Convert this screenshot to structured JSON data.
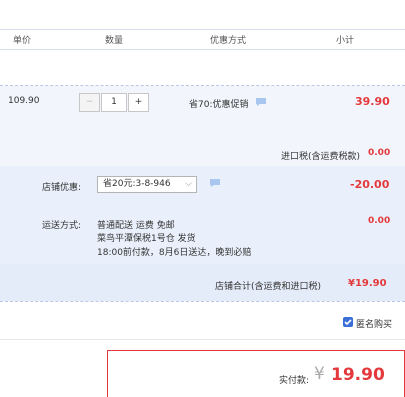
{
  "table_header": {
    "unit_price": "单价",
    "quantity": "数量",
    "discount_method": "优惠方式",
    "subtotal": "小计"
  },
  "item": {
    "unit_price": "109.90",
    "quantity": "1",
    "minus": "−",
    "plus": "+",
    "discount": "省70:优惠促销",
    "subtotal": "39.90"
  },
  "import_tax": {
    "label": "进口税(含运费税款)",
    "value": "0.00"
  },
  "shop_discount": {
    "label": "店铺优惠:",
    "selected": "省20元:3-8-946",
    "value": "-20.00"
  },
  "shipping": {
    "label": "运送方式:",
    "line1": "普通配送 运费 免邮",
    "line2": "菜鸟平潭保税1号仓  发货",
    "line3": "18:00前付款，8月6日送达，晚到必赔",
    "value": "0.00"
  },
  "shop_total": {
    "label": "店铺合计(含运费和进口税)",
    "value": "¥19.90"
  },
  "anonymous": {
    "label": "匿名购买",
    "checked": true
  },
  "payment": {
    "label": "实付款:",
    "currency": "¥",
    "amount": "19.90"
  },
  "colors": {
    "accent": "#e4393c",
    "checkbox": "#3b6fd8",
    "bg_item": "#f2f5fb",
    "bg_shop": "#eaf0fb"
  }
}
